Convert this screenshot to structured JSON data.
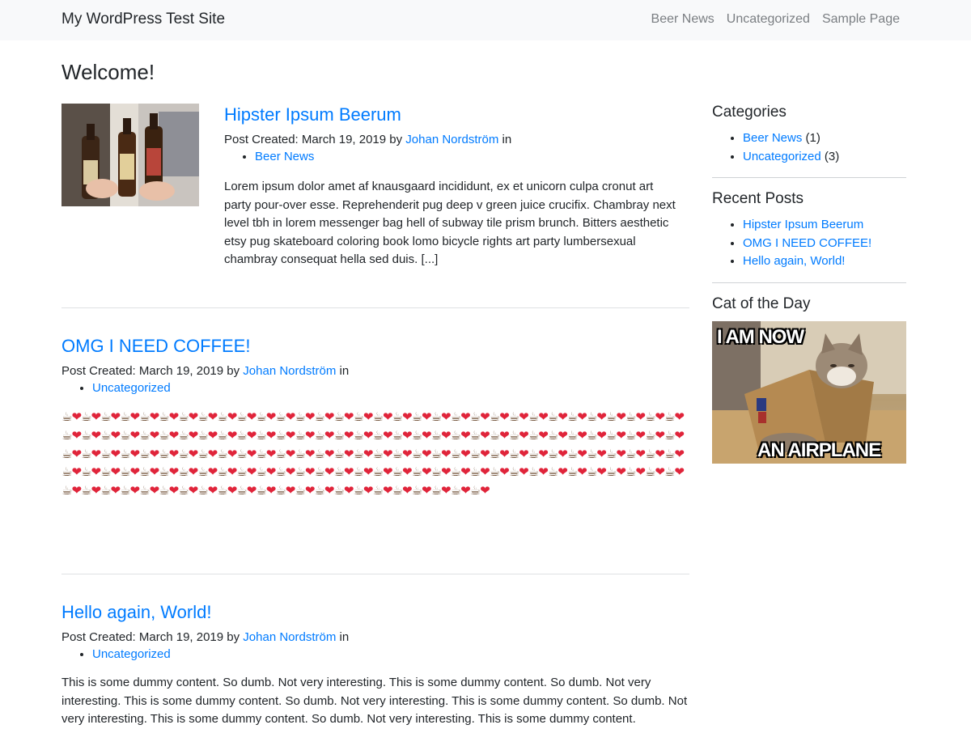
{
  "navbar": {
    "brand": "My WordPress Test Site",
    "links": [
      "Beer News",
      "Uncategorized",
      "Sample Page"
    ]
  },
  "page": {
    "title": "Welcome!"
  },
  "posts": [
    {
      "title": "Hipster Ipsum Beerum",
      "meta_prefix": "Post Created: March 19, 2019 by",
      "author": "Johan Nordström",
      "meta_suffix": "in",
      "category": "Beer News",
      "excerpt": "Lorem ipsum dolor amet af knausgaard incididunt, ex et unicorn culpa cronut art party pour-over esse. Reprehenderit pug deep v green juice crucifix. Chambray next level tbh in lorem messenger bag hell of subway tile prism brunch. Bitters aesthetic etsy pug skateboard coloring book lomo bicycle rights art party lumbersexual chambray consequat hella sed duis. [...]"
    },
    {
      "title": "OMG I NEED COFFEE!",
      "meta_prefix": "Post Created: March 19, 2019 by",
      "author": "Johan Nordström",
      "meta_suffix": "in",
      "category": "Uncategorized",
      "emoji_pairs": 150
    },
    {
      "title": "Hello again, World!",
      "meta_prefix": "Post Created: March 19, 2019 by",
      "author": "Johan Nordström",
      "meta_suffix": "in",
      "category": "Uncategorized",
      "excerpt": "This is some dummy content. So dumb. Not very interesting. This is some dummy content. So dumb. Not very interesting. This is some dummy content. So dumb. Not very interesting. This is some dummy content. So dumb. Not very interesting. This is some dummy content. So dumb. Not very interesting. This is some dummy content."
    }
  ],
  "sidebar": {
    "categories": {
      "title": "Categories",
      "items": [
        {
          "label": "Beer News",
          "count": "(1)"
        },
        {
          "label": "Uncategorized",
          "count": "(3)"
        }
      ]
    },
    "recent_posts": {
      "title": "Recent Posts",
      "items": [
        "Hipster Ipsum Beerum",
        "OMG I NEED COFFEE!",
        "Hello again, World!"
      ]
    },
    "cat_of_day": {
      "title": "Cat of the Day",
      "caption_top": "I AM NOW",
      "caption_bottom": "AN AIRPLANE"
    }
  },
  "colors": {
    "link": "#007bff",
    "text": "#212529",
    "navbar_bg": "#f8f9fa"
  }
}
